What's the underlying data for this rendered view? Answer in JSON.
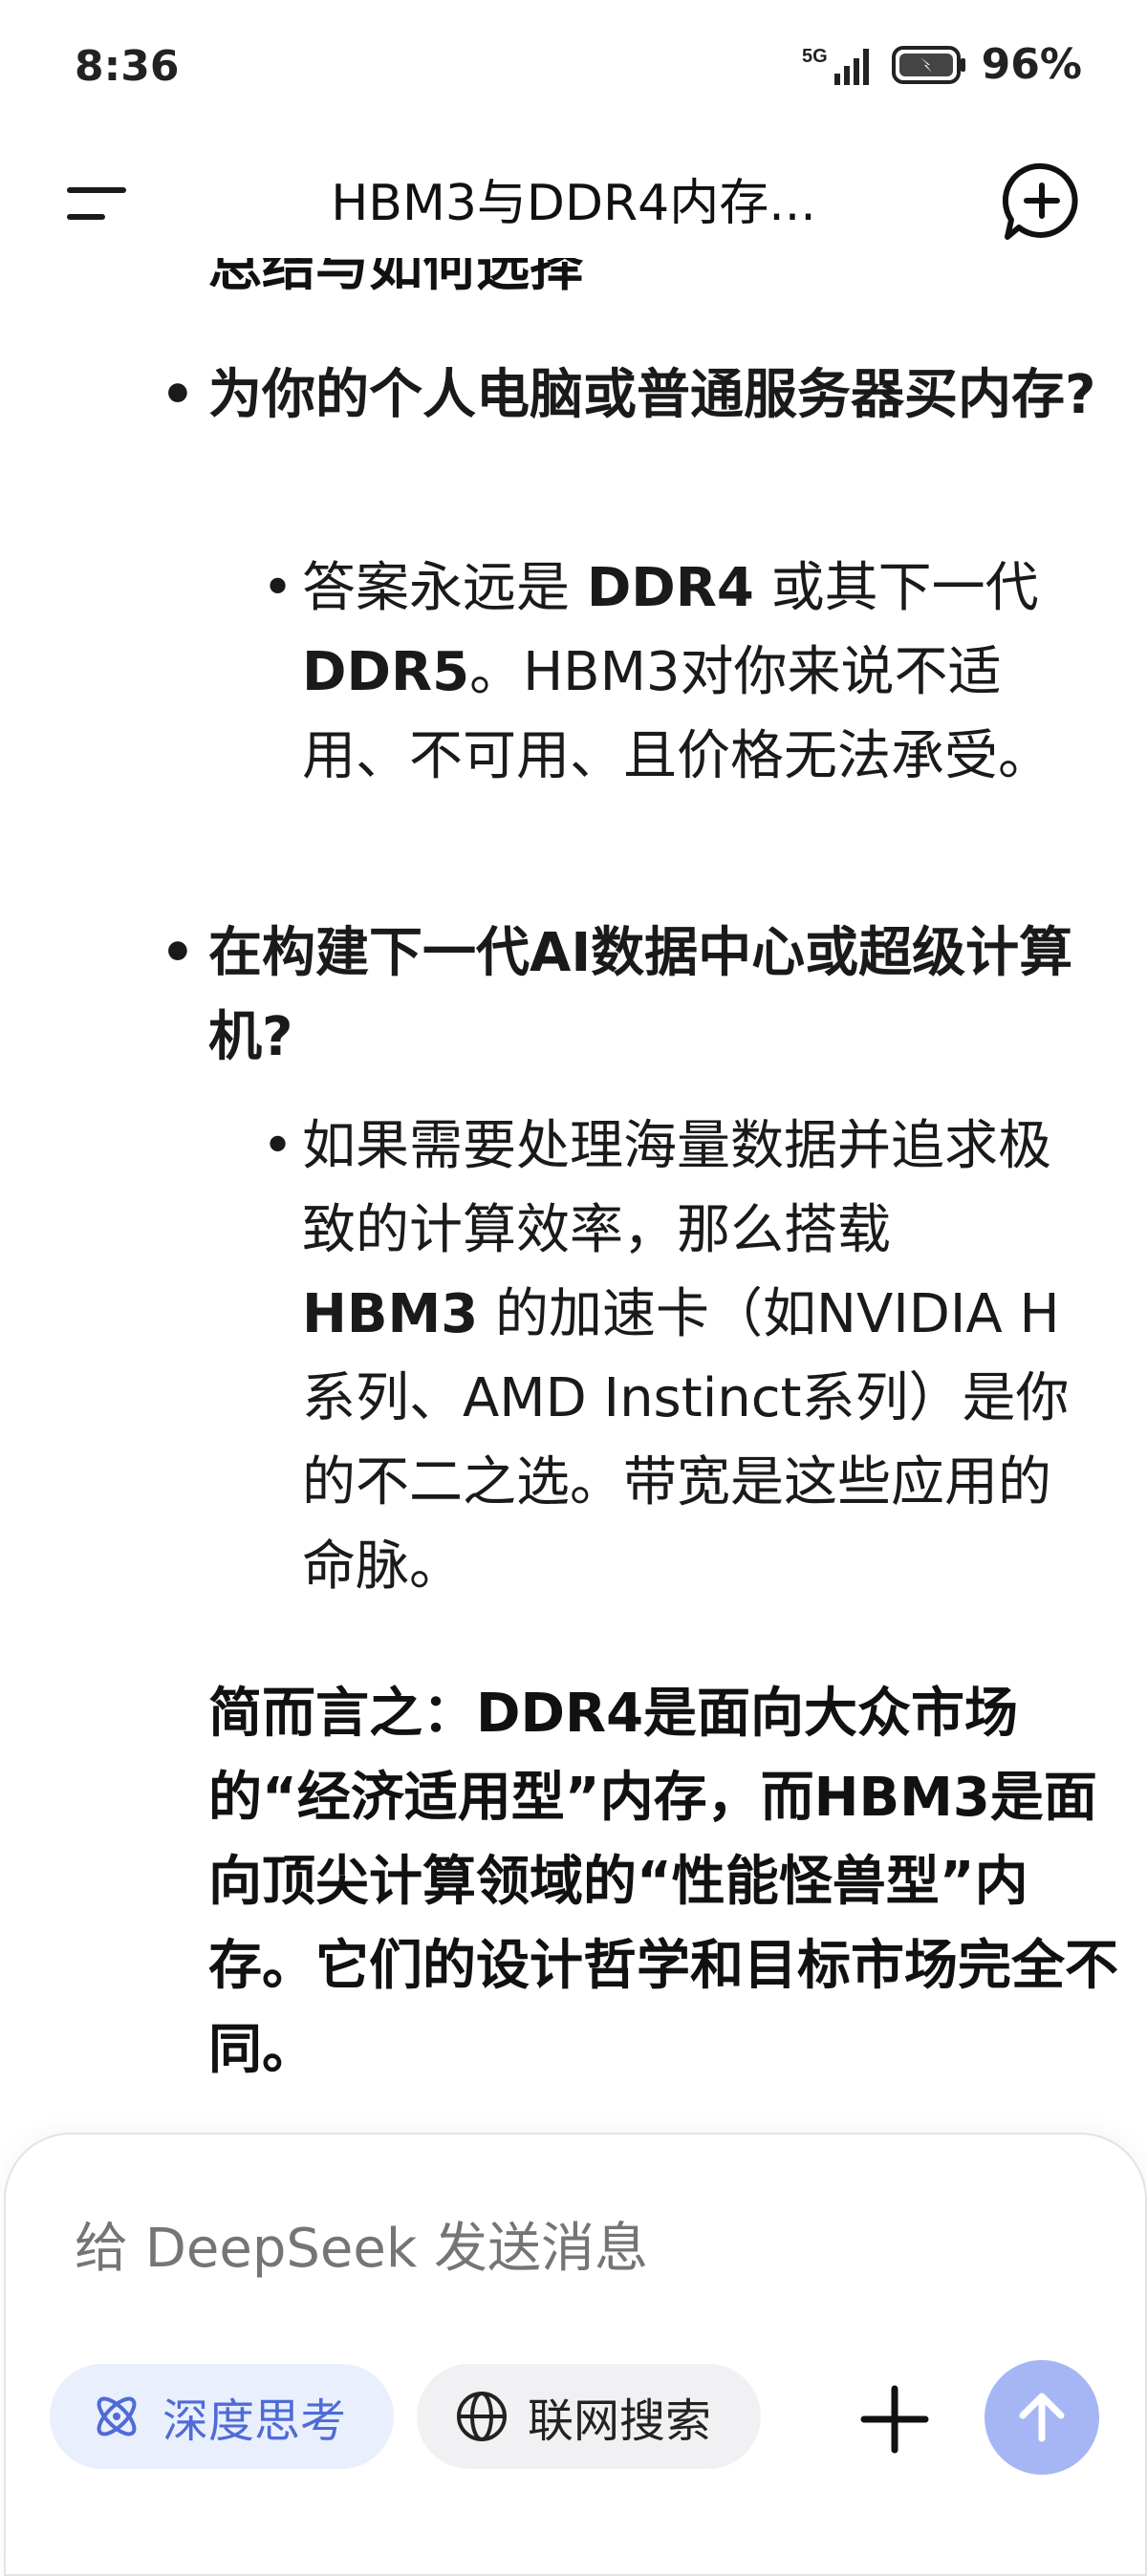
{
  "status_bar": {
    "time": "8:36",
    "network_label": "5G",
    "battery_percent": "96%"
  },
  "header": {
    "title": "HBM3与DDR4内存..."
  },
  "conversation": {
    "clipped_heading_fragment": "总结与如何选择",
    "bullet1": {
      "text": "为你的个人电脑或普通服务器买内存?",
      "sub": {
        "t1": "答案永远是 ",
        "b1": "DDR4",
        "t2": " 或其下一代 ",
        "b2": "DDR5",
        "t3": "。HBM3对你来说不适用、不可用、且价格无法承受。"
      }
    },
    "bullet2": {
      "text": "在构建下一代AI数据中心或超级计算机?",
      "sub": {
        "t1": "如果需要处理海量数据并追求极致的计算效率，那么搭载 ",
        "b1": "HBM3",
        "t2": " 的加速卡（如NVIDIA H系列、AMD Instinct系列）是你的不二之选。带宽是这些应用的命脉。"
      }
    },
    "summary": "简而言之：DDR4是面向大众市场的“经济适用型”内存，而HBM3是面向顶尖计算领域的“性能怪兽型”内存。它们的设计哲学和目标市场完全不同。"
  },
  "composer": {
    "placeholder": "给 DeepSeek 发送消息",
    "deep_think_label": "深度思考",
    "web_search_label": "联网搜索"
  },
  "colors": {
    "accent": "#4f6bd6",
    "send_button": "#a6b6f5"
  }
}
